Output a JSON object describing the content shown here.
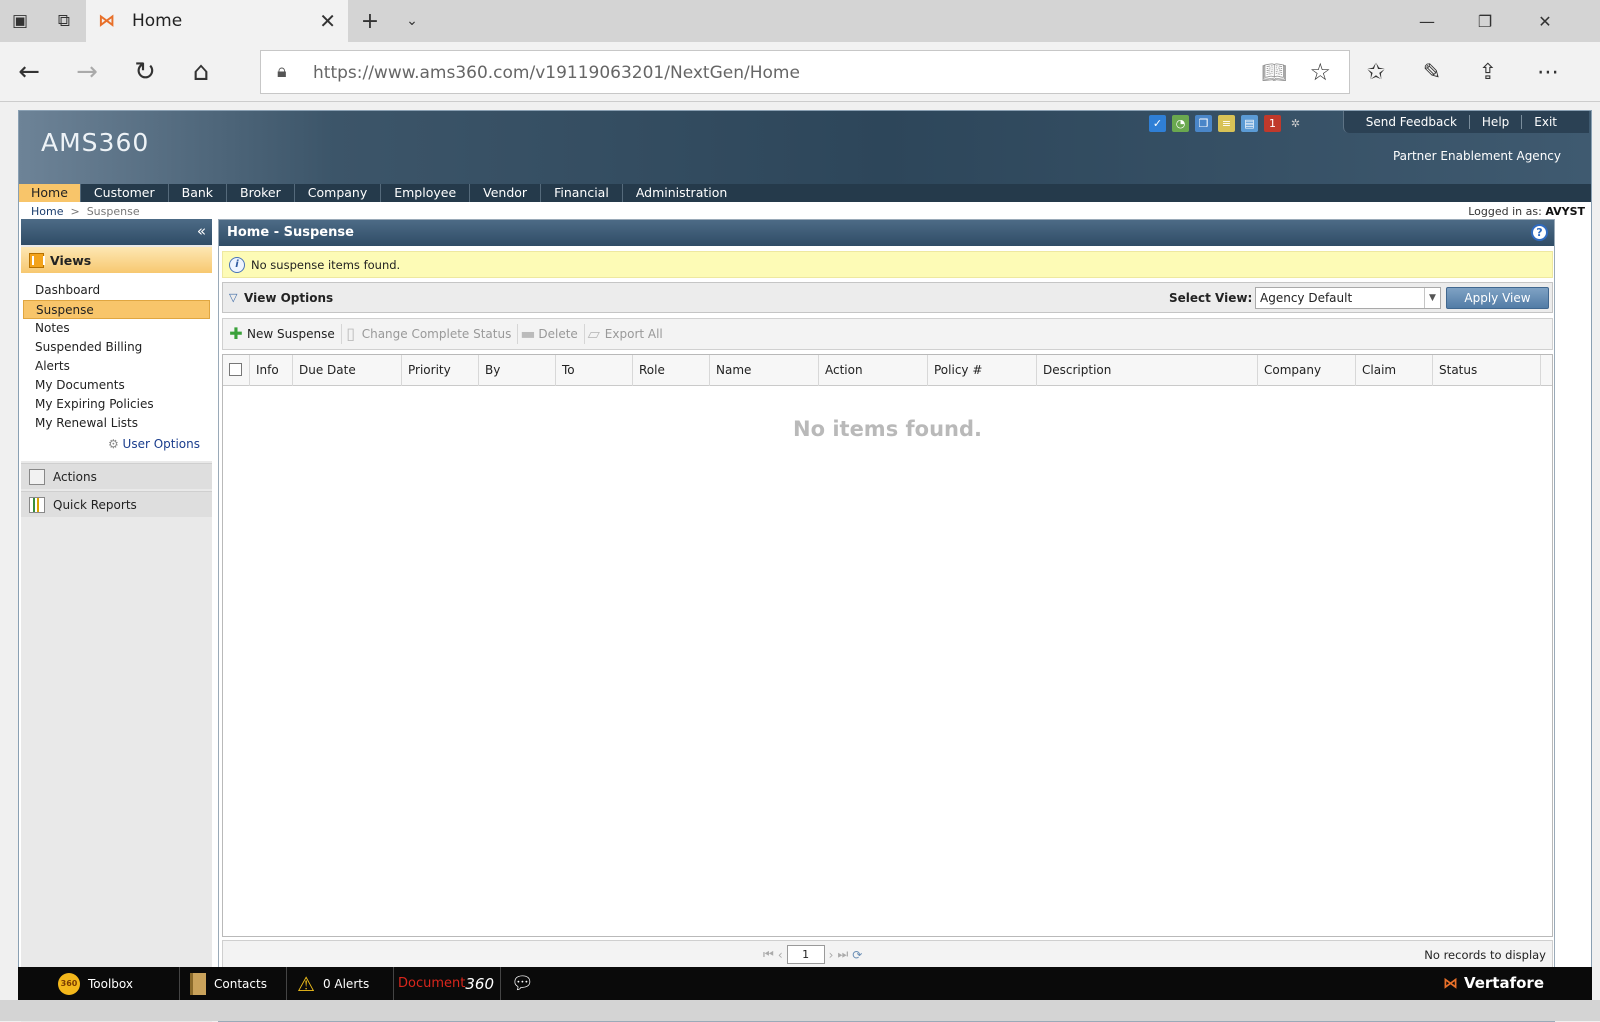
{
  "browser": {
    "tab_title": "Home",
    "url": "https://www.ams360.com/v19119063201/NextGen/Home"
  },
  "header": {
    "brand": "AMS360",
    "links": [
      "Send Feedback",
      "Help",
      "Exit"
    ],
    "agency": "Partner Enablement Agency",
    "icon_names": [
      "check-icon",
      "dial-icon",
      "copy-icon",
      "ledger-icon",
      "form-icon",
      "calendar-icon",
      "settings-icon"
    ]
  },
  "topnav": {
    "items": [
      "Home",
      "Customer",
      "Bank",
      "Broker",
      "Company",
      "Employee",
      "Vendor",
      "Financial",
      "Administration"
    ],
    "active": "Home"
  },
  "breadcrumb": {
    "home": "Home",
    "separator": ">",
    "current": "Suspense"
  },
  "logged_in": {
    "label": "Logged in as:",
    "user": "AVYST"
  },
  "sidebar": {
    "collapse": "«",
    "views_title": "Views",
    "views": [
      "Dashboard",
      "Suspense",
      "Notes",
      "Suspended Billing",
      "Alerts",
      "My Documents",
      "My Expiring Policies",
      "My Renewal Lists"
    ],
    "active_view": "Suspense",
    "user_options": "User Options",
    "sections": [
      "Actions",
      "Quick Reports"
    ]
  },
  "main": {
    "title": "Home - Suspense",
    "info": "No suspense items found.",
    "view_options": "View Options",
    "select_view_label": "Select View:",
    "select_view_value": "Agency Default",
    "apply_view": "Apply View",
    "toolbar": {
      "new_suspense": "New Suspense",
      "change_complete_status": "Change Complete Status",
      "delete": "Delete",
      "export_all": "Export All"
    },
    "columns": [
      "Info",
      "Due Date",
      "Priority",
      "By",
      "To",
      "Role",
      "Name",
      "Action",
      "Policy #",
      "Description",
      "Company",
      "Claim",
      "Status"
    ],
    "empty_message": "No items found.",
    "pager": {
      "page": "1",
      "status": "No records to display"
    }
  },
  "taskbar": {
    "toolbox": "Toolbox",
    "toolbox_badge": "360",
    "contacts": "Contacts",
    "alerts": "0 Alerts",
    "document": "Document",
    "document_suffix": "360",
    "brand": "Vertafore"
  },
  "colors": {
    "header_dark": "#2d465a",
    "nav_active": "#f8c56a",
    "info_bar": "#fdfbb6",
    "apply_button": "#527ca6",
    "document_red": "#d9261c",
    "vertafore_orange": "#e8702a"
  }
}
